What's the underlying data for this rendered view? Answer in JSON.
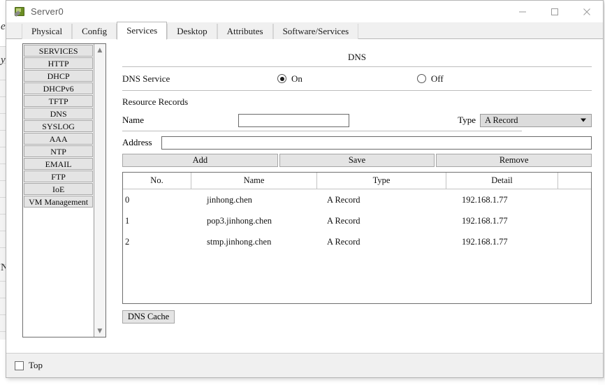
{
  "window": {
    "title": "Server0",
    "icon": "server-icon",
    "controls": {
      "minimize": "minimize-icon",
      "maximize": "maximize-icon",
      "close": "close-icon"
    }
  },
  "tabs": [
    {
      "label": "Physical",
      "active": false
    },
    {
      "label": "Config",
      "active": false
    },
    {
      "label": "Services",
      "active": true
    },
    {
      "label": "Desktop",
      "active": false
    },
    {
      "label": "Attributes",
      "active": false
    },
    {
      "label": "Software/Services",
      "active": false
    }
  ],
  "sidebar": {
    "items": [
      {
        "label": "SERVICES"
      },
      {
        "label": "HTTP"
      },
      {
        "label": "DHCP"
      },
      {
        "label": "DHCPv6"
      },
      {
        "label": "TFTP"
      },
      {
        "label": "DNS"
      },
      {
        "label": "SYSLOG"
      },
      {
        "label": "AAA"
      },
      {
        "label": "NTP"
      },
      {
        "label": "EMAIL"
      },
      {
        "label": "FTP"
      },
      {
        "label": "IoE"
      },
      {
        "label": "VM Management"
      }
    ],
    "scroll_up": "▲",
    "scroll_down": "▼"
  },
  "panel": {
    "title": "DNS",
    "service_label": "DNS Service",
    "radio_on": "On",
    "radio_off": "Off",
    "service_state": "On",
    "resource_records_label": "Resource Records",
    "name_label": "Name",
    "name_value": "",
    "name_placeholder": "",
    "type_label": "Type",
    "type_value": "A Record",
    "type_caret": "caret-down-icon",
    "address_label": "Address",
    "address_value": "",
    "address_placeholder": "",
    "buttons": {
      "add": "Add",
      "save": "Save",
      "remove": "Remove"
    },
    "dns_cache_button": "DNS Cache",
    "table": {
      "headers": [
        "No.",
        "Name",
        "Type",
        "Detail",
        ""
      ],
      "rows": [
        {
          "no": "0",
          "name": "jinhong.chen",
          "type": "A Record",
          "detail": "192.168.1.77"
        },
        {
          "no": "1",
          "name": "pop3.jinhong.chen",
          "type": "A Record",
          "detail": "192.168.1.77"
        },
        {
          "no": "2",
          "name": "stmp.jinhong.chen",
          "type": "A Record",
          "detail": "192.168.1.77"
        }
      ]
    }
  },
  "footer": {
    "top_checkbox_label": "Top",
    "top_checked": false
  },
  "background": {
    "glyph_1": "e",
    "glyph_2": "y",
    "glyph_3": "N"
  },
  "colors": {
    "window_bg": "#f0f0f0",
    "panel_bg": "#ffffff",
    "button_face": "#e4e4e4",
    "border": "#a6a6a6",
    "text": "#111111",
    "icon_green": "#6b8e23"
  }
}
